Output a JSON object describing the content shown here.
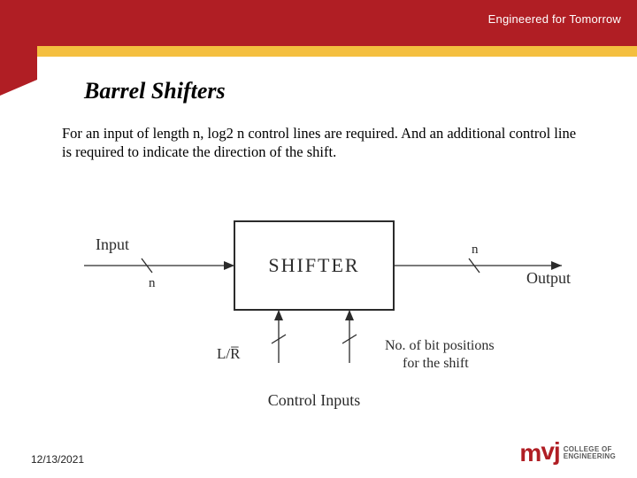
{
  "header": {
    "tagline": "Engineered for Tomorrow"
  },
  "title": "Barrel Shifters",
  "body": "For an input of length n, log2 n control lines are required. And an additional control line is required to indicate the direction of the shift.",
  "diagram": {
    "block_label": "SHIFTER",
    "input_label": "Input",
    "input_width": "n",
    "output_label": "Output",
    "output_width": "n",
    "ctrl_left_label": "L/R̅",
    "ctrl_right_l1": "No. of bit positions",
    "ctrl_right_l2": "for the shift",
    "bottom_label": "Control Inputs"
  },
  "footer": {
    "date": "12/13/2021",
    "logo_mark": "mvj",
    "logo_line1": "COLLEGE OF",
    "logo_line2": "ENGINEERING"
  }
}
